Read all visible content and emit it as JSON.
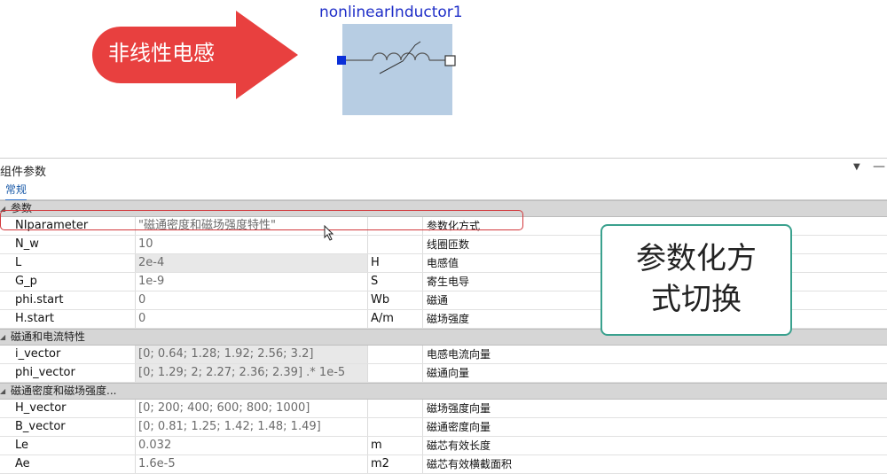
{
  "diagram": {
    "arrow_label": "非线性电感",
    "arrow_color": "#e8403f",
    "component_name": "nonlinearInductor1",
    "component_fill": "#b7cde3",
    "port_left_color": "#0a2fd8"
  },
  "panel": {
    "title": "组件参数",
    "ctrl_down": "▼",
    "ctrl_min": "—",
    "tab": "常规"
  },
  "sections": [
    {
      "label": "参数",
      "rows": [
        {
          "name": "NIparameter",
          "value": "\"磁通密度和磁场强度特性\"",
          "unit": "",
          "desc": "参数化方式"
        },
        {
          "name": "N_w",
          "value": "10",
          "unit": "",
          "desc": "线圈匝数"
        },
        {
          "name": "L",
          "value": "2e-4",
          "unit": "H",
          "desc": "电感值"
        },
        {
          "name": "G_p",
          "value": "1e-9",
          "unit": "S",
          "desc": "寄生电导"
        },
        {
          "name": "phi.start",
          "value": "0",
          "unit": "Wb",
          "desc": "磁通"
        },
        {
          "name": "H.start",
          "value": "0",
          "unit": "A/m",
          "desc": "磁场强度"
        }
      ]
    },
    {
      "label": "磁通和电流特性",
      "rows": [
        {
          "name": "i_vector",
          "value": "[0; 0.64; 1.28; 1.92; 2.56; 3.2]",
          "unit": "",
          "desc": "电感电流向量"
        },
        {
          "name": "phi_vector",
          "value": "[0; 1.29; 2; 2.27; 2.36; 2.39] .* 1e-5",
          "unit": "",
          "desc": "磁通向量"
        }
      ]
    },
    {
      "label": "磁通密度和磁场强度...",
      "rows": [
        {
          "name": "H_vector",
          "value": "[0; 200; 400; 600; 800; 1000]",
          "unit": "",
          "desc": "磁场强度向量"
        },
        {
          "name": "B_vector",
          "value": "[0; 0.81; 1.25; 1.42; 1.48; 1.49]",
          "unit": "",
          "desc": "磁通密度向量"
        },
        {
          "name": "Le",
          "value": "0.032",
          "unit": "m",
          "desc": "磁芯有效长度"
        },
        {
          "name": "Ae",
          "value": "1.6e-5",
          "unit": "m2",
          "desc": "磁芯有效横截面积"
        }
      ]
    }
  ],
  "callout": {
    "line1": "参数化方",
    "line2": "式切换",
    "border_color": "#3aa18e"
  },
  "highlight_color": "#d2373b"
}
